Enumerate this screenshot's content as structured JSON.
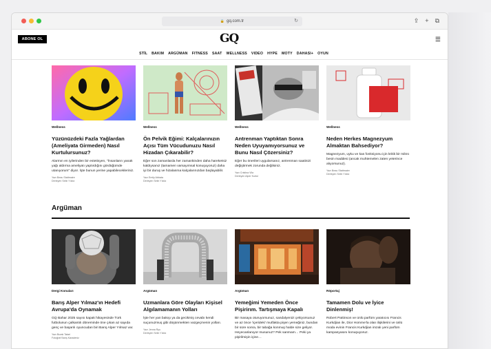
{
  "browser": {
    "url": "gq.com.tr"
  },
  "header": {
    "subscribe_label": "ABONE OL",
    "logo": "GQ",
    "nav": [
      "STİL",
      "BAKIM",
      "ARGÜMAN",
      "FITNESS",
      "SAAT",
      "WELLNESS",
      "VIDEO",
      "HYPE",
      "MOTY",
      "DAHASI+",
      "OYUN"
    ]
  },
  "top_articles": [
    {
      "category": "Wellness",
      "title": "Yüzünüzdeki Fazla Yağlardan (Ameliyata Girmeden) Nasıl Kurtulursunuz?",
      "desc": "Alarmın en iyilerinden bir estetisyen, \"İnsanların yanak yağı aldırma ameliyatı yaptırdığını gördüğümde utanıyorum\" diyor. İşte bunun yerine yapabilecekleriniz.",
      "author": "Yazı Beau Stattmaire",
      "translator": "Derleyen Selin Yıldız"
    },
    {
      "category": "Wellness",
      "title": "Ön Pelvik Eğimi: Kalçalarınızın Açısı Tüm Vücudunuzu Nasıl Hizadan Çıkarabilir?",
      "desc": "Eğer son zamanlarda her zamankinden daha hareketsiz kaldıysanız (tamamen varsayımsal konuşuyoruz) daha iyi bir duruş ve hizalanma kalçalarınızdan başlayabilir.",
      "author": "Yazı Emily Abbata",
      "translator": "Derleyen Selin Yıldız"
    },
    {
      "category": "Wellness",
      "title": "Antrenman Yaptıktan Sonra Neden Uyuyamıyorsunuz ve Bunu Nasıl Çözersiniz?",
      "desc": "Eğer bu önerileri uygularsanız, antrenman saatinizi değiştirmek zorunda değilsiniz.",
      "author": "Yazı Cristina Vila",
      "translator": "Derleyen Alper Kurtul"
    },
    {
      "category": "Wellness",
      "title": "Neden Herkes Magnezyum Almaktan Bahsediyor?",
      "desc": "Magnezyum, uyku ve kas fonksiyonu için kritik bir mikro besin maddesi (ancak muhtemelen zaten yeterince alıyorsunuz).",
      "author": "Yazı Beau Stattmaire",
      "translator": "Derleyen Selin Yıldız"
    }
  ],
  "section": {
    "title": "Argüman"
  },
  "bottom_articles": [
    {
      "category": "Dergi Konuları",
      "title": "Barış Alper Yılmaz'ın Hedefi Avrupa'da Oynamak",
      "desc": "GQ Bahar 2025 sayısı kapak hikayesinde Türk futbolunun çalkantılı döneminde öne çıkan az sayıda genç ve başarılı oyuncudan biri Barış Alper Yılmaz var.",
      "author": "Yazı Burak Tatari",
      "translator": "Fotoğraf Barış Karadeniz"
    },
    {
      "category": "Argüman",
      "title": "Uzmanlara Göre Olayları Kişisel Algılamamanın Yolları",
      "desc": "İşte her yan bakışı ya da gecikmiş cevabı kendi suçunuzmuş gibi düşünmekten vazgeçmenin yolları.",
      "author": "Yazı Jenna Ryu",
      "translator": "Derleyen Selin Yıldız"
    },
    {
      "category": "Argüman",
      "title": "Yemeğimi Yemeden Önce Pişirirım. Tartışmaya Kapalı",
      "desc": "Bir masaya oturuyorsunuz, sandalyenizi çekiyorsunuz ve az önce 'içerideki' mutfakta pişen yemeğiniz, bundan bir süre sonra, bir tabağa konmuş halde size geliyor. Heyecanlanıyor musunuz? Pek sanmam… Peki ya pişirilmişin içine…",
      "author": "",
      "translator": ""
    },
    {
      "category": "Röportaj",
      "title": "Tamamen Dolu ve İyice Dinlenmiş!",
      "desc": "Robert Pattinson ve ünlü parfüm yaratıcısı Francis Kurkdjian ile, Dior Homme'la olan ilişkilerini ve ünlü moda evinin Francis Kurkdjian imzalı yeni parfüm kampanyasını konuşuyoruz.",
      "author": "",
      "translator": ""
    }
  ],
  "colors": {
    "accent_black": "#000000",
    "sleep_red": "#c8332b",
    "mg_red": "#d9292c"
  }
}
